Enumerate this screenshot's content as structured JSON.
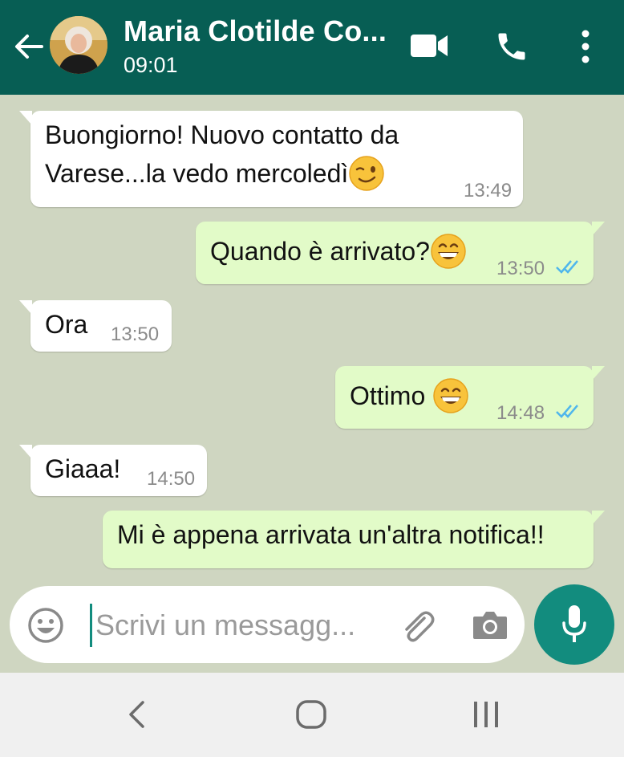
{
  "header": {
    "contact_name": "Maria Clotilde Co...",
    "status": "09:01",
    "icons": [
      "back-arrow-icon",
      "avatar",
      "video-call-icon",
      "phone-icon",
      "more-options-icon"
    ],
    "bg_color": "#075e54"
  },
  "messages": [
    {
      "direction": "incoming",
      "lines": [
        "Buongiorno! Nuovo contatto da",
        "Varese...la vedo mercoledì"
      ],
      "emoji": "winking-face",
      "time": "13:49"
    },
    {
      "direction": "outgoing",
      "text": "Quando è arrivato?",
      "emoji": "grinning-face",
      "time": "13:50",
      "status": "read"
    },
    {
      "direction": "incoming",
      "text": "Ora",
      "time": "13:50"
    },
    {
      "direction": "outgoing",
      "text": "Ottimo ",
      "emoji": "grinning-face",
      "time": "14:48",
      "status": "read"
    },
    {
      "direction": "incoming",
      "text": "Giaaa!",
      "time": "14:50"
    },
    {
      "direction": "outgoing",
      "text": "Mi è appena arrivata un'altra notifica!!"
    }
  ],
  "composer": {
    "placeholder": "Scrivi un messagg...",
    "icons": [
      "emoji-icon",
      "attach-icon",
      "camera-icon",
      "mic-icon"
    ]
  },
  "navbar": {
    "icons": [
      "nav-back-icon",
      "nav-home-icon",
      "nav-recents-icon"
    ]
  },
  "colors": {
    "chat_bg": "#cfd6c1",
    "outgoing_bubble": "#e2fbc8",
    "incoming_bubble": "#ffffff",
    "read_ticks": "#4fb6ec",
    "accent": "#128c7e"
  }
}
